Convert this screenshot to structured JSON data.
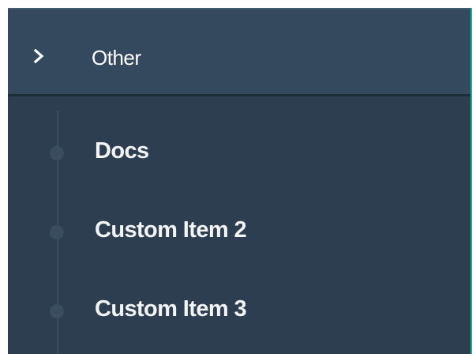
{
  "colors": {
    "sidebar_bg": "#2c3e50",
    "header_bg": "#34495e",
    "accent": "#1fae94",
    "text": "#ffffff",
    "tree_line": "#3a4d5f"
  },
  "section": {
    "title": "Other",
    "expanded": true,
    "icon": "chevron-right-icon"
  },
  "items": [
    {
      "label": "Docs",
      "icon": "dot-icon"
    },
    {
      "label": "Custom Item 2",
      "icon": "dot-icon"
    },
    {
      "label": "Custom Item 3",
      "icon": "dot-icon"
    }
  ]
}
